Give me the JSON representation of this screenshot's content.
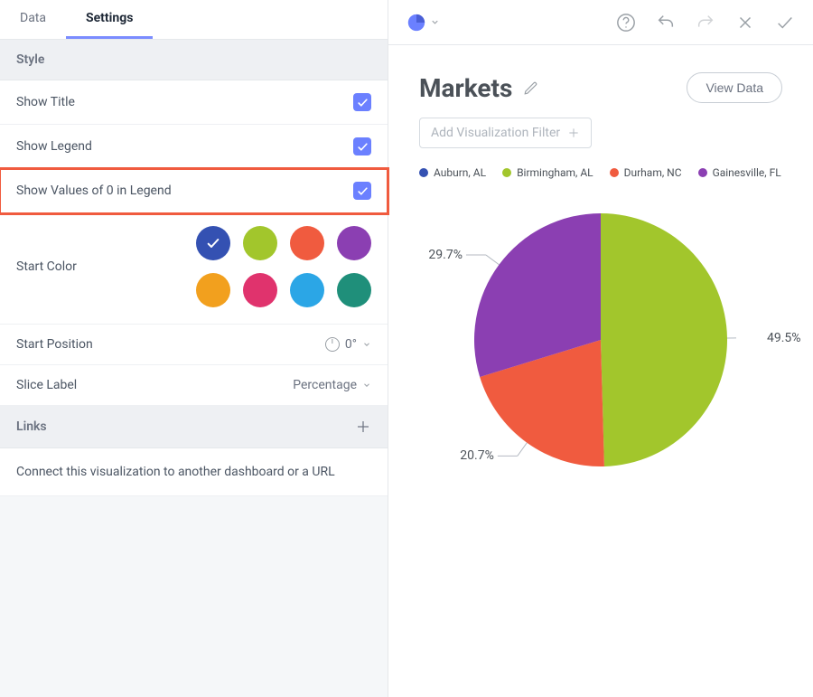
{
  "tabs": {
    "data": "Data",
    "settings": "Settings",
    "active": "settings"
  },
  "section_style": "Style",
  "settings": {
    "show_title": {
      "label": "Show Title",
      "checked": true
    },
    "show_legend": {
      "label": "Show Legend",
      "checked": true
    },
    "show_zero_legend": {
      "label": "Show Values of 0 in Legend",
      "checked": true,
      "highlight": true
    },
    "start_color": {
      "label": "Start Color",
      "selected": 0,
      "options": [
        "#3451b2",
        "#a2c62c",
        "#f05b3f",
        "#8b3fb2",
        "#f2a01e",
        "#e0336d",
        "#2ba6e6",
        "#1f8f7a"
      ]
    },
    "start_position": {
      "label": "Start Position",
      "value": "0°"
    },
    "slice_label": {
      "label": "Slice Label",
      "value": "Percentage"
    }
  },
  "links": {
    "header": "Links",
    "description": "Connect this visualization to another dashboard or a URL"
  },
  "chart": {
    "title": "Markets",
    "view_data_label": "View Data",
    "filter_placeholder": "Add Visualization Filter"
  },
  "chart_data": {
    "type": "pie",
    "title": "Markets",
    "series": [
      {
        "name": "Auburn, AL",
        "value": 0.0,
        "color": "#3451b2",
        "label": ""
      },
      {
        "name": "Birmingham, AL",
        "value": 49.5,
        "color": "#a2c62c",
        "label": "49.5%"
      },
      {
        "name": "Durham, NC",
        "value": 20.7,
        "color": "#f05b3f",
        "label": "20.7%"
      },
      {
        "name": "Gainesville, FL",
        "value": 29.7,
        "color": "#8b3fb2",
        "label": "29.7%"
      }
    ],
    "slice_label_type": "Percentage",
    "start_position_deg": 0,
    "legend_position": "top"
  }
}
